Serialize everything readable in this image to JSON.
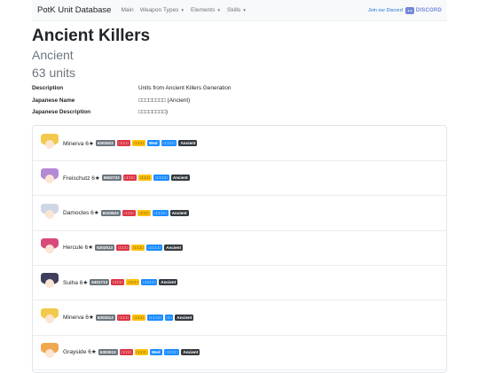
{
  "nav": {
    "brand": "PotK Unit Database",
    "items": [
      {
        "label": "Main",
        "dropdown": false
      },
      {
        "label": "Weapon Types",
        "dropdown": true
      },
      {
        "label": "Elements",
        "dropdown": true
      },
      {
        "label": "Skills",
        "dropdown": true
      }
    ],
    "join_text": "Join our Discord",
    "discord_text": "DISCORD"
  },
  "page": {
    "title": "Ancient Killers",
    "subtitle": "Ancient",
    "count": "63 units"
  },
  "info": [
    {
      "key": "Description",
      "value": "Units from Ancient Killers Generation"
    },
    {
      "key": "Japanese Name",
      "value": "□□□□□□□□ (Ancient)"
    },
    {
      "key": "Japanese Description",
      "value": "□□□□□□□□)"
    }
  ],
  "units": [
    {
      "name": "Minerva 6★",
      "hair": "#f2c94c",
      "badges": [
        {
          "text": "6302522",
          "kind": "id"
        },
        {
          "text": "□□□□",
          "kind": "red"
        },
        {
          "text": "□□□□",
          "kind": "yellow"
        },
        {
          "text": "Wed",
          "kind": "blue"
        },
        {
          "text": "□□□□□",
          "kind": "blue"
        },
        {
          "text": "Ancient",
          "kind": "dark"
        }
      ]
    },
    {
      "name": "Freischutz 6★",
      "hair": "#b48ad6",
      "badges": [
        {
          "text": "6502723",
          "kind": "id"
        },
        {
          "text": "□□□□",
          "kind": "red"
        },
        {
          "text": "□□□□",
          "kind": "yellow"
        },
        {
          "text": "□□□□□",
          "kind": "blue"
        },
        {
          "text": "Ancient",
          "kind": "dark"
        }
      ]
    },
    {
      "name": "Damocles 6★",
      "hair": "#cfd6e6",
      "badges": [
        {
          "text": "6103523",
          "kind": "id"
        },
        {
          "text": "□□□□",
          "kind": "red"
        },
        {
          "text": "□□□□",
          "kind": "yellow"
        },
        {
          "text": "□□□□□",
          "kind": "blue"
        },
        {
          "text": "Ancient",
          "kind": "dark"
        }
      ]
    },
    {
      "name": "Hercule 6★",
      "hair": "#d94a7a",
      "badges": [
        {
          "text": "6202513",
          "kind": "id"
        },
        {
          "text": "□□□□",
          "kind": "red"
        },
        {
          "text": "□□□□",
          "kind": "yellow"
        },
        {
          "text": "□□□□□",
          "kind": "blue"
        },
        {
          "text": "Ancient",
          "kind": "dark"
        }
      ]
    },
    {
      "name": "Suiha 6★",
      "hair": "#3d3f5c",
      "badges": [
        {
          "text": "6401713",
          "kind": "id"
        },
        {
          "text": "□□□□",
          "kind": "red"
        },
        {
          "text": "□□□□",
          "kind": "yellow"
        },
        {
          "text": "□□□□□",
          "kind": "blue"
        },
        {
          "text": "Ancient",
          "kind": "dark"
        }
      ]
    },
    {
      "name": "Minerva 6★",
      "hair": "#f2c94c",
      "badges": [
        {
          "text": "6302513",
          "kind": "id"
        },
        {
          "text": "□□□□",
          "kind": "red"
        },
        {
          "text": "□□□□",
          "kind": "yellow"
        },
        {
          "text": "□□□□□",
          "kind": "blue"
        },
        {
          "text": "□□",
          "kind": "blue"
        },
        {
          "text": "Ancient",
          "kind": "dark"
        }
      ]
    },
    {
      "name": "Grayside 6★",
      "hair": "#f0a850",
      "badges": [
        {
          "text": "6302613",
          "kind": "id"
        },
        {
          "text": "□□□□",
          "kind": "red"
        },
        {
          "text": "□□□□",
          "kind": "yellow"
        },
        {
          "text": "Wed",
          "kind": "blue"
        },
        {
          "text": "□□□□□",
          "kind": "blue"
        },
        {
          "text": "Ancient",
          "kind": "dark"
        }
      ]
    }
  ]
}
